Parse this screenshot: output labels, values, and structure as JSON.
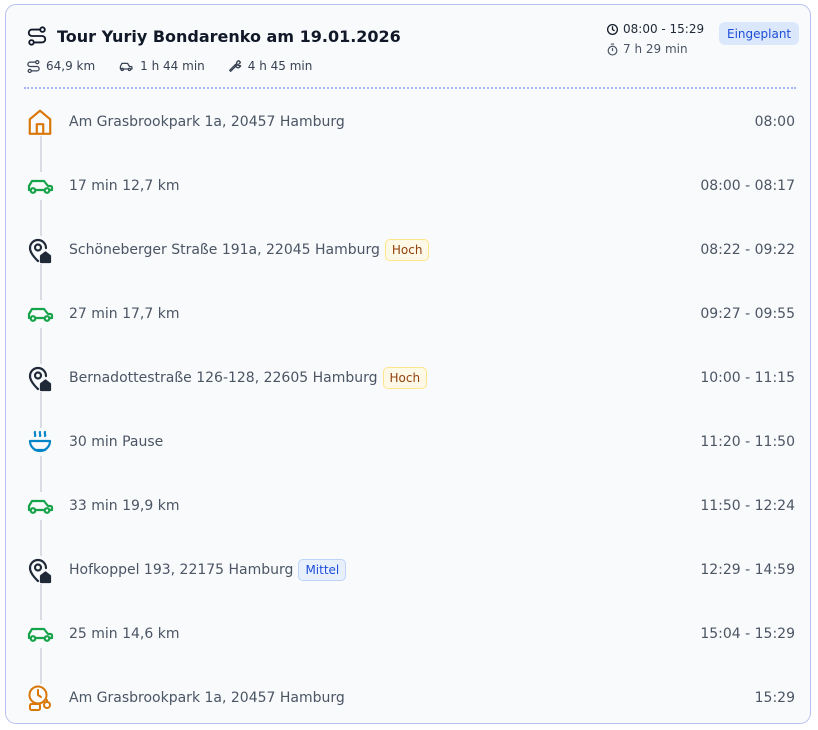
{
  "header": {
    "title": "Tour Yuriy Bondarenko am 19.01.2026",
    "distance": "64,9 km",
    "drive_time": "1 h 44 min",
    "work_time": "4 h 45 min",
    "time_window": "08:00 - 15:29",
    "duration": "7 h 29 min",
    "status": "Eingeplant"
  },
  "colors": {
    "drive": "#16a34a",
    "home": "#d97706",
    "pause": "#0284c7",
    "stop": "#1f2937",
    "status_bg": "#dbe7fb",
    "status_text": "#1d4ed8"
  },
  "stops": [
    {
      "type": "home",
      "icon": "home-icon",
      "label": "Am Grasbrookpark 1a, 20457 Hamburg",
      "time": "08:00"
    },
    {
      "type": "drive",
      "icon": "car-icon",
      "label": "17 min 12,7 km",
      "time": "08:00 - 08:17"
    },
    {
      "type": "stop",
      "icon": "location-pin-icon",
      "label": "Schöneberger Straße 191a, 22045 Hamburg",
      "priority": "Hoch",
      "time": "08:22 - 09:22"
    },
    {
      "type": "drive",
      "icon": "car-icon",
      "label": "27 min 17,7 km",
      "time": "09:27 - 09:55"
    },
    {
      "type": "stop",
      "icon": "location-pin-icon",
      "label": "Bernadottestraße 126-128, 22605 Hamburg",
      "priority": "Hoch",
      "time": "10:00 - 11:15"
    },
    {
      "type": "pause",
      "icon": "soup-bowl-icon",
      "label": "30 min Pause",
      "time": "11:20 - 11:50"
    },
    {
      "type": "drive",
      "icon": "car-icon",
      "label": "33 min 19,9 km",
      "time": "11:50 - 12:24"
    },
    {
      "type": "stop",
      "icon": "location-pin-icon",
      "label": "Hofkoppel 193, 22175 Hamburg",
      "priority": "Mittel",
      "time": "12:29 - 14:59"
    },
    {
      "type": "drive",
      "icon": "car-icon",
      "label": "25 min 14,6 km",
      "time": "15:04 - 15:29"
    },
    {
      "type": "end",
      "icon": "clock-end-icon",
      "label": "Am Grasbrookpark 1a, 20457 Hamburg",
      "time": "15:29"
    }
  ]
}
